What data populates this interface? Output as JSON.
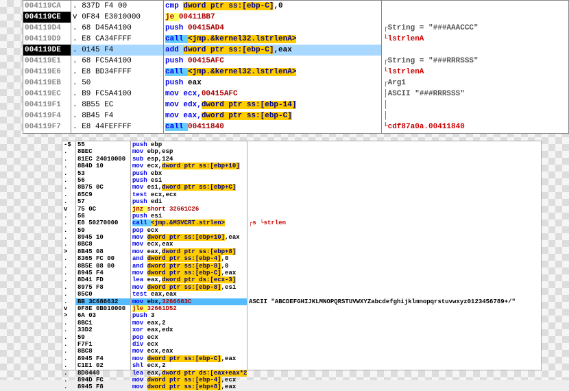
{
  "top": {
    "rows": [
      {
        "addr": "004119CA",
        "addr_active": false,
        "hex": ". 837D F4 00",
        "asm": [
          {
            "t": "cmp ",
            "c": "mnem"
          },
          {
            "t": "dword ptr ss:[ebp-C]",
            "c": "op-mem"
          },
          {
            "t": ",0",
            "c": "op"
          }
        ],
        "hl": false,
        "cmt": ""
      },
      {
        "addr": "004119CE",
        "addr_active": true,
        "hex": "v 0F84 E3010000",
        "asm": [
          {
            "t": "je ",
            "c": "mnem-jmp"
          },
          {
            "t": "00411BB7",
            "c": "op-addr"
          }
        ],
        "hl": false,
        "cmt": ""
      },
      {
        "addr": "004119D4",
        "addr_active": false,
        "hex": ". 68 D45A4100",
        "asm": [
          {
            "t": "push ",
            "c": "mnem"
          },
          {
            "t": "00415AD4",
            "c": "op-addr"
          }
        ],
        "hl": false,
        "cmt": "┌String = \"###AAACCC\""
      },
      {
        "addr": "004119D9",
        "addr_active": false,
        "hex": ". E8 CA34FFFF",
        "asm": [
          {
            "t": "call ",
            "c": "mnem-call"
          },
          {
            "t": "<jmp.&kernel32.lstrlenA>",
            "c": "op-mem"
          }
        ],
        "hl": false,
        "cmt": "└lstrlenA",
        "cmt_cls": "cmt-red"
      },
      {
        "addr": "004119DE",
        "addr_active": true,
        "hex": ". 0145 F4",
        "asm": [
          {
            "t": "add ",
            "c": "mnem"
          },
          {
            "t": "dword ptr ss:[ebp-C]",
            "c": "op-mem"
          },
          {
            "t": ",eax",
            "c": "op"
          }
        ],
        "hl": true,
        "cmt": ""
      },
      {
        "addr": "004119E1",
        "addr_active": false,
        "hex": ". 68 FC5A4100",
        "asm": [
          {
            "t": "push ",
            "c": "mnem"
          },
          {
            "t": "00415AFC",
            "c": "op-addr"
          }
        ],
        "hl": false,
        "cmt": "┌String = \"###RRRSSS\""
      },
      {
        "addr": "004119E6",
        "addr_active": false,
        "hex": ". E8 BD34FFFF",
        "asm": [
          {
            "t": "call ",
            "c": "mnem-call"
          },
          {
            "t": "<jmp.&kernel32.lstrlenA>",
            "c": "op-mem"
          }
        ],
        "hl": false,
        "cmt": "└lstrlenA",
        "cmt_cls": "cmt-red"
      },
      {
        "addr": "004119EB",
        "addr_active": false,
        "hex": ". 50",
        "asm": [
          {
            "t": "push ",
            "c": "mnem"
          },
          {
            "t": "eax",
            "c": "op"
          }
        ],
        "hl": false,
        "cmt": "┌Arg1"
      },
      {
        "addr": "004119EC",
        "addr_active": false,
        "hex": ". B9 FC5A4100",
        "asm": [
          {
            "t": "mov ecx,",
            "c": "mnem"
          },
          {
            "t": "00415AFC",
            "c": "op-addr"
          }
        ],
        "hl": false,
        "cmt": "│ASCII \"###RRRSSS\""
      },
      {
        "addr": "004119F1",
        "addr_active": false,
        "hex": ". 8B55 EC",
        "asm": [
          {
            "t": "mov edx,",
            "c": "mnem"
          },
          {
            "t": "dword ptr ss:[ebp-14]",
            "c": "op-mem"
          }
        ],
        "hl": false,
        "cmt": "│"
      },
      {
        "addr": "004119F4",
        "addr_active": false,
        "hex": ". 8B45 F4",
        "asm": [
          {
            "t": "mov eax,",
            "c": "mnem"
          },
          {
            "t": "dword ptr ss:[ebp-C]",
            "c": "op-mem"
          }
        ],
        "hl": false,
        "cmt": "│"
      },
      {
        "addr": "004119F7",
        "addr_active": false,
        "hex": ". E8 44FEFFFF",
        "asm": [
          {
            "t": "call ",
            "c": "mnem-call"
          },
          {
            "t": "00411840",
            "c": "op-addr"
          }
        ],
        "hl": false,
        "cmt": "└cdf87a0a.00411840",
        "cmt_cls": "cmt-red"
      }
    ]
  },
  "bottom": {
    "rows": [
      {
        "mark": "-$",
        "hex": "55",
        "asm": [
          {
            "t": "push ",
            "c": "b-mnem"
          },
          {
            "t": "ebp"
          }
        ]
      },
      {
        "mark": ".",
        "hex": "8BEC",
        "asm": [
          {
            "t": "mov ",
            "c": "b-mnem"
          },
          {
            "t": "ebp,esp"
          }
        ]
      },
      {
        "mark": ".",
        "hex": "81EC 24010000",
        "asm": [
          {
            "t": "sub ",
            "c": "b-mnem"
          },
          {
            "t": "esp,124"
          }
        ]
      },
      {
        "mark": ".",
        "hex": "8B4D 10",
        "asm": [
          {
            "t": "mov ",
            "c": "b-mnem"
          },
          {
            "t": "ecx,"
          },
          {
            "t": "dword ptr ss:[ebp+10]",
            "c": "b-mem"
          }
        ]
      },
      {
        "mark": ".",
        "hex": "53",
        "asm": [
          {
            "t": "push ",
            "c": "b-mnem"
          },
          {
            "t": "ebx"
          }
        ]
      },
      {
        "mark": ".",
        "hex": "56",
        "asm": [
          {
            "t": "push ",
            "c": "b-mnem"
          },
          {
            "t": "esi"
          }
        ]
      },
      {
        "mark": ".",
        "hex": "8B75 0C",
        "asm": [
          {
            "t": "mov ",
            "c": "b-mnem"
          },
          {
            "t": "esi,"
          },
          {
            "t": "dword ptr ss:[ebp+C]",
            "c": "b-mem"
          }
        ]
      },
      {
        "mark": ".",
        "hex": "85C9",
        "asm": [
          {
            "t": "test ",
            "c": "b-mnem"
          },
          {
            "t": "ecx,ecx"
          }
        ]
      },
      {
        "mark": ".",
        "hex": "57",
        "asm": [
          {
            "t": "push ",
            "c": "b-mnem"
          },
          {
            "t": "edi"
          }
        ]
      },
      {
        "mark": "v",
        "hex": "75 0C",
        "asm": [
          {
            "t": "jnz ",
            "c": "b-jmp"
          },
          {
            "t": "short 32661C26",
            "c": "b-addr2"
          }
        ]
      },
      {
        "mark": ".",
        "hex": "56",
        "asm": [
          {
            "t": "push ",
            "c": "b-mnem"
          },
          {
            "t": "esi"
          }
        ]
      },
      {
        "mark": ".",
        "hex": "E8 50270000",
        "asm": [
          {
            "t": "call ",
            "c": "b-call"
          },
          {
            "t": "<jmp.&MSVCRT.strlen>",
            "c": "b-mem"
          }
        ],
        "cmt": "┌s\n└strlen",
        "cmt_cls": "b-cmt-red"
      },
      {
        "mark": ".",
        "hex": "59",
        "asm": [
          {
            "t": "pop ",
            "c": "b-mnem"
          },
          {
            "t": "ecx"
          }
        ]
      },
      {
        "mark": ".",
        "hex": "8945 10",
        "asm": [
          {
            "t": "mov ",
            "c": "b-mnem"
          },
          {
            "t": "dword ptr ss:[ebp+10]",
            "c": "b-mem"
          },
          {
            "t": ",eax"
          }
        ]
      },
      {
        "mark": ".",
        "hex": "8BC8",
        "asm": [
          {
            "t": "mov ",
            "c": "b-mnem"
          },
          {
            "t": "ecx,eax"
          }
        ]
      },
      {
        "mark": ">",
        "hex": "8B45 08",
        "asm": [
          {
            "t": "mov ",
            "c": "b-mnem"
          },
          {
            "t": "eax,"
          },
          {
            "t": "dword ptr ss:[ebp+8]",
            "c": "b-mem"
          }
        ]
      },
      {
        "mark": ".",
        "hex": "8365 FC 00",
        "asm": [
          {
            "t": "and ",
            "c": "b-mnem"
          },
          {
            "t": "dword ptr ss:[ebp-4]",
            "c": "b-mem"
          },
          {
            "t": ",0"
          }
        ]
      },
      {
        "mark": ".",
        "hex": "8B5E 08 00",
        "asm": [
          {
            "t": "and ",
            "c": "b-mnem"
          },
          {
            "t": "dword ptr ss:[ebp-8]",
            "c": "b-mem"
          },
          {
            "t": ",0"
          }
        ]
      },
      {
        "mark": ".",
        "hex": "8945 F4",
        "asm": [
          {
            "t": "mov ",
            "c": "b-mnem"
          },
          {
            "t": "dword ptr ss:[ebp-C]",
            "c": "b-mem"
          },
          {
            "t": ",eax"
          }
        ]
      },
      {
        "mark": ".",
        "hex": "8D41 FD",
        "asm": [
          {
            "t": "lea ",
            "c": "b-mnem"
          },
          {
            "t": "eax,"
          },
          {
            "t": "dword ptr ds:[ecx-3]",
            "c": "b-mem"
          }
        ]
      },
      {
        "mark": ".",
        "hex": "8975 F8",
        "asm": [
          {
            "t": "mov ",
            "c": "b-mnem"
          },
          {
            "t": "dword ptr ss:[ebp-8]",
            "c": "b-mem"
          },
          {
            "t": ",esi"
          }
        ]
      },
      {
        "mark": ".",
        "hex": "85C0",
        "asm": [
          {
            "t": "test ",
            "c": "b-mnem"
          },
          {
            "t": "eax,eax"
          }
        ]
      },
      {
        "mark": ".",
        "hex": "BB 3C686632",
        "asm": [
          {
            "t": "mov ",
            "c": "b-mnem"
          },
          {
            "t": "ebx,"
          },
          {
            "t": "3266683C",
            "c": "b-addr2"
          }
        ],
        "hl": true,
        "cmt": "ASCII \"ABCDEFGHIJKLMNOPQRSTUVWXYZabcdefghijklmnopqrstuvwxyz0123456789+/\""
      },
      {
        "mark": "v",
        "hex": "0F8E 0B010000",
        "asm": [
          {
            "t": "jle ",
            "c": "b-jmp"
          },
          {
            "t": "32661D52",
            "c": "b-addr2"
          }
        ]
      },
      {
        "mark": ">",
        "hex": "6A 03",
        "asm": [
          {
            "t": "push ",
            "c": "b-mnem"
          },
          {
            "t": "3"
          }
        ]
      },
      {
        "mark": ".",
        "hex": "8BC1",
        "asm": [
          {
            "t": "mov ",
            "c": "b-mnem"
          },
          {
            "t": "eax,2"
          }
        ]
      },
      {
        "mark": ".",
        "hex": "33D2",
        "asm": [
          {
            "t": "xor ",
            "c": "b-mnem"
          },
          {
            "t": "eax,edx"
          }
        ]
      },
      {
        "mark": ".",
        "hex": "59",
        "asm": [
          {
            "t": "pop ",
            "c": "b-mnem"
          },
          {
            "t": "ecx"
          }
        ]
      },
      {
        "mark": ".",
        "hex": "F7F1",
        "asm": [
          {
            "t": "div ",
            "c": "b-mnem"
          },
          {
            "t": "ecx"
          }
        ]
      },
      {
        "mark": ".",
        "hex": "8BC8",
        "asm": [
          {
            "t": "mov ",
            "c": "b-mnem"
          },
          {
            "t": "ecx,eax"
          }
        ]
      },
      {
        "mark": ".",
        "hex": "8945 F4",
        "asm": [
          {
            "t": "mov ",
            "c": "b-mnem"
          },
          {
            "t": "dword ptr ss:[ebp-C]",
            "c": "b-mem"
          },
          {
            "t": ",eax"
          }
        ]
      },
      {
        "mark": ".",
        "hex": "C1E1 02",
        "asm": [
          {
            "t": "shl ",
            "c": "b-mnem"
          },
          {
            "t": "ecx,2"
          }
        ]
      },
      {
        "mark": ".",
        "hex": "8D0440",
        "asm": [
          {
            "t": "lea ",
            "c": "b-mnem"
          },
          {
            "t": "eax,"
          },
          {
            "t": "dword ptr ds:[eax+eax*2]",
            "c": "b-mem"
          }
        ]
      },
      {
        "mark": ".",
        "hex": "894D FC",
        "asm": [
          {
            "t": "mov ",
            "c": "b-mnem"
          },
          {
            "t": "dword ptr ss:[ebp-4]",
            "c": "b-mem"
          },
          {
            "t": ",ecx"
          }
        ]
      },
      {
        "mark": ".",
        "hex": "8945 F8",
        "asm": [
          {
            "t": "mov ",
            "c": "b-mnem"
          },
          {
            "t": "dword ptr ss:[ebp+8]",
            "c": "b-mem"
          },
          {
            "t": ",eax"
          }
        ]
      }
    ]
  }
}
